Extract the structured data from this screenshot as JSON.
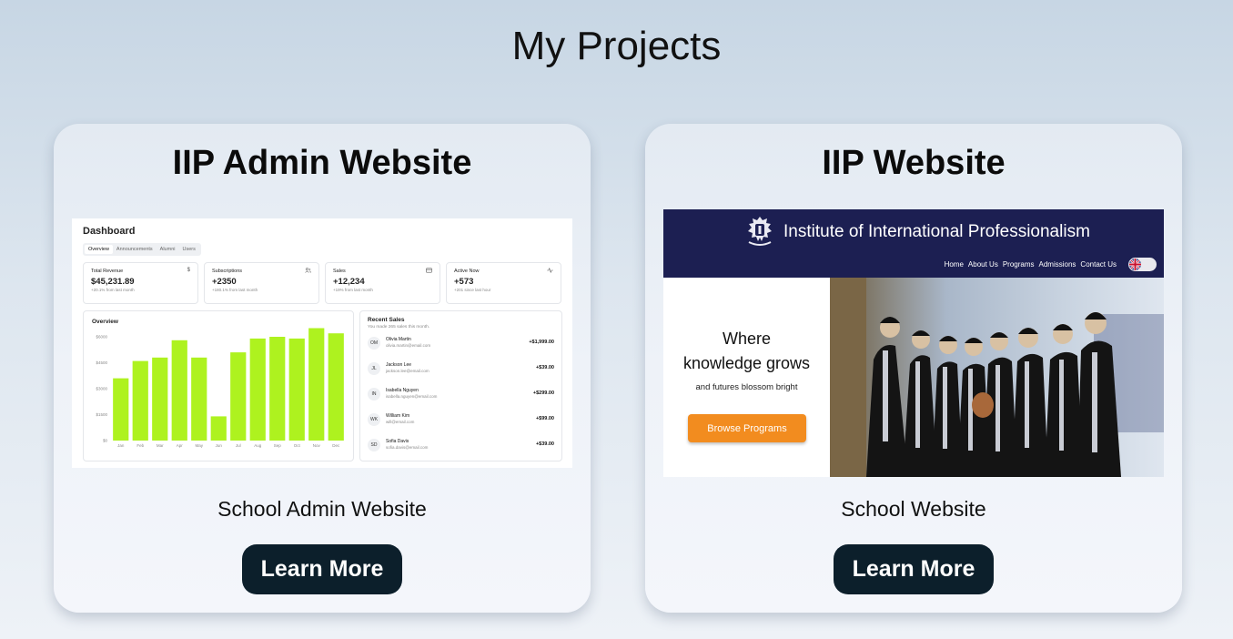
{
  "page": {
    "title": "My Projects"
  },
  "projects": [
    {
      "title": "IIP Admin Website",
      "subtitle": "School Admin Website",
      "button": "Learn More",
      "preview": {
        "heading": "Dashboard",
        "tabs": [
          "Overview",
          "Announcements",
          "Alumni",
          "Users"
        ],
        "stats": [
          {
            "label": "Total Revenue",
            "icon": "$",
            "value": "$45,231.89",
            "sub": "+20.1% from last month"
          },
          {
            "label": "Subscriptions",
            "icon": "users-icon",
            "value": "+2350",
            "sub": "+180.1% from last month"
          },
          {
            "label": "Sales",
            "icon": "card-icon",
            "value": "+12,234",
            "sub": "+19% from last month"
          },
          {
            "label": "Active Now",
            "icon": "activity-icon",
            "value": "+573",
            "sub": "+201 since last hour"
          }
        ],
        "overview_title": "Overview",
        "recent_sales_title": "Recent Sales",
        "recent_sales_sub": "You made 265 sales this month.",
        "sales": [
          {
            "initials": "OM",
            "name": "Olivia Martin",
            "email": "olivia.martin@email.com",
            "amount": "+$1,999.00"
          },
          {
            "initials": "JL",
            "name": "Jackson Lee",
            "email": "jackson.lee@email.com",
            "amount": "+$39.00"
          },
          {
            "initials": "IN",
            "name": "Isabella Nguyen",
            "email": "isabella.nguyen@email.com",
            "amount": "+$299.00"
          },
          {
            "initials": "WK",
            "name": "William Kim",
            "email": "will@email.com",
            "amount": "+$99.00"
          },
          {
            "initials": "SD",
            "name": "Sofia Davis",
            "email": "sofia.davis@email.com",
            "amount": "+$39.00"
          }
        ]
      }
    },
    {
      "title": "IIP Website",
      "subtitle": "School Website",
      "button": "Learn More",
      "preview": {
        "school_name": "Institute of International Professionalism",
        "nav": [
          "Home",
          "About Us",
          "Programs",
          "Admissions",
          "Contact Us"
        ],
        "hero_line1": "Where",
        "hero_line2": "knowledge grows",
        "hero_sub": "and futures blossom bright",
        "hero_button": "Browse Programs"
      }
    }
  ],
  "chart_data": {
    "type": "bar",
    "categories": [
      "Jan",
      "Feb",
      "Mar",
      "Apr",
      "May",
      "Jun",
      "Jul",
      "Aug",
      "Sep",
      "Oct",
      "Nov",
      "Dec"
    ],
    "values": [
      3600,
      4600,
      4800,
      5800,
      4800,
      1400,
      5100,
      5900,
      6000,
      5900,
      6500,
      6200
    ],
    "yticks": [
      "$6000",
      "$4500",
      "$3000",
      "$1500",
      "$0"
    ],
    "ylim": [
      0,
      6000
    ],
    "bar_color": "#aef21f"
  },
  "colors": {
    "button_bg": "#0c1f2b",
    "school_header": "#1c1f52",
    "hero_button": "#f28c1f"
  }
}
